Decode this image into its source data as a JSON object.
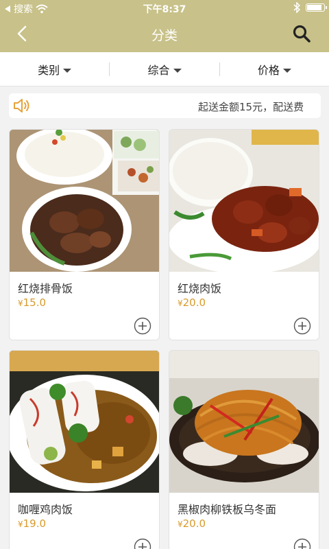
{
  "status_bar": {
    "carrier": "搜索",
    "time": "下午8:37",
    "battery_level": 0.9
  },
  "nav": {
    "title": "分类"
  },
  "filters": [
    {
      "label": "类别"
    },
    {
      "label": "综合"
    },
    {
      "label": "价格"
    }
  ],
  "notice": {
    "text": "起送金额15元，配送费"
  },
  "currency": "¥",
  "dishes": [
    {
      "name": "红烧排骨饭",
      "price": "15.0"
    },
    {
      "name": "红烧肉饭",
      "price": "20.0"
    },
    {
      "name": "咖喱鸡肉饭",
      "price": "19.0"
    },
    {
      "name": "黑椒肉柳铁板乌冬面",
      "price": "20.0"
    }
  ],
  "colors": {
    "header": "#c8c189",
    "price": "#d89a2b"
  }
}
